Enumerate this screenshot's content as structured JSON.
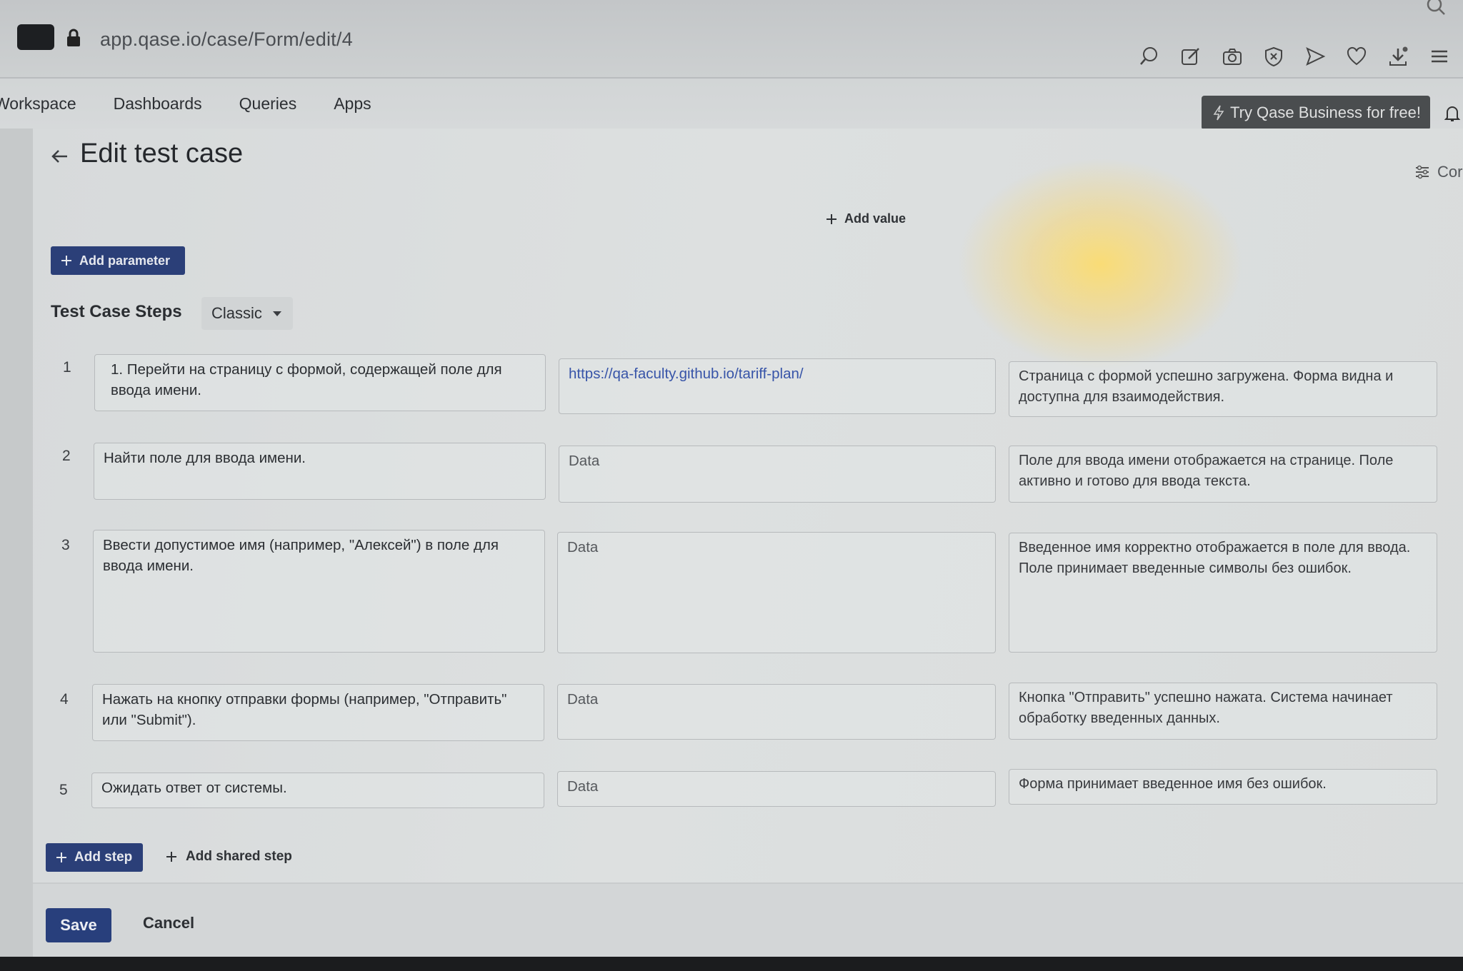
{
  "browser": {
    "url": "app.qase.io/case/Form/edit/4"
  },
  "nav": {
    "items": [
      {
        "label": "Workspace"
      },
      {
        "label": "Dashboards"
      },
      {
        "label": "Queries"
      },
      {
        "label": "Apps"
      }
    ],
    "cta_label": "Try Qase Business for free!"
  },
  "page": {
    "title": "Edit test case",
    "columns_label": "Cor"
  },
  "parameters": {
    "add_value_label": "Add value",
    "add_parameter_label": "Add parameter"
  },
  "steps_section": {
    "title": "Test Case Steps",
    "view_mode": "Classic",
    "steps": [
      {
        "number": "1",
        "action": "1. Перейти на страницу с формой, содержащей поле для ввода имени.",
        "data": "https://qa-faculty.github.io/tariff-plan/",
        "expected": "Страница с формой успешно загружена. Форма видна и доступна для взаимодействия."
      },
      {
        "number": "2",
        "action": "Найти поле для ввода имени.",
        "data": "Data",
        "expected": "Поле для ввода имени отображается на странице. Поле активно и готово для ввода текста."
      },
      {
        "number": "3",
        "action": "Ввести допустимое имя (например, \"Алексей\") в поле для ввода имени.",
        "data": "Data",
        "expected": "Введенное имя корректно отображается в поле для ввода. Поле принимает введенные символы без ошибок."
      },
      {
        "number": "4",
        "action": "Нажать на кнопку отправки формы (например, \"Отправить\" или \"Submit\").",
        "data": "Data",
        "expected": "Кнопка \"Отправить\" успешно нажата. Система начинает обработку введенных данных."
      },
      {
        "number": "5",
        "action": "Ожидать ответ от системы.",
        "data": "Data",
        "expected": "Форма принимает введенное имя без ошибок."
      }
    ],
    "add_step_label": "Add step",
    "add_shared_step_label": "Add shared step"
  },
  "footer": {
    "save_label": "Save",
    "cancel_label": "Cancel"
  },
  "colors": {
    "primary_button": "#2b3f78",
    "link": "#3754a8"
  }
}
